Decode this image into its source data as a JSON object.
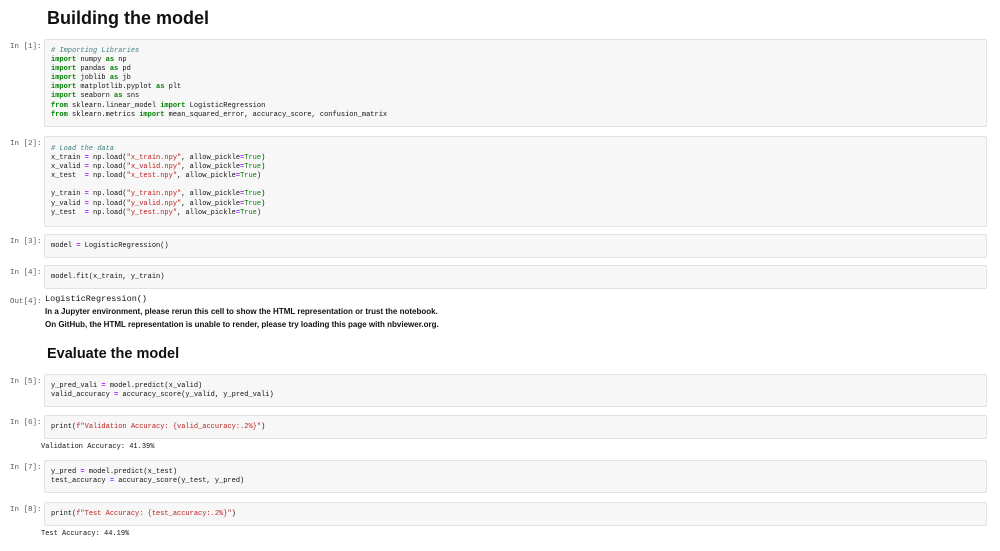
{
  "headings": {
    "build": "Building the model",
    "evaluate": "Evaluate the model"
  },
  "cells": [
    {
      "prompt": "In [1]:",
      "lines": [
        [
          {
            "t": "# Importing Libraries",
            "c": "cm"
          }
        ],
        [
          {
            "t": "import",
            "c": "kw"
          },
          {
            "t": " numpy "
          },
          {
            "t": "as",
            "c": "kw"
          },
          {
            "t": " np"
          }
        ],
        [
          {
            "t": "import",
            "c": "kw"
          },
          {
            "t": " pandas "
          },
          {
            "t": "as",
            "c": "kw"
          },
          {
            "t": " pd"
          }
        ],
        [
          {
            "t": "import",
            "c": "kw"
          },
          {
            "t": " joblib "
          },
          {
            "t": "as",
            "c": "kw"
          },
          {
            "t": " jb"
          }
        ],
        [
          {
            "t": "import",
            "c": "kw"
          },
          {
            "t": " matplotlib.pyplot "
          },
          {
            "t": "as",
            "c": "kw"
          },
          {
            "t": " plt"
          }
        ],
        [
          {
            "t": "import",
            "c": "kw"
          },
          {
            "t": " seaborn "
          },
          {
            "t": "as",
            "c": "kw"
          },
          {
            "t": " sns"
          }
        ],
        [
          {
            "t": "from",
            "c": "kw"
          },
          {
            "t": " sklearn.linear_model "
          },
          {
            "t": "import",
            "c": "kw"
          },
          {
            "t": " LogisticRegression"
          }
        ],
        [
          {
            "t": "from",
            "c": "kw"
          },
          {
            "t": " sklearn.metrics "
          },
          {
            "t": "import",
            "c": "kw"
          },
          {
            "t": " mean_squared_error, accuracy_score, confusion_matrix"
          }
        ]
      ]
    },
    {
      "prompt": "In [2]:",
      "lines": [
        [
          {
            "t": "# Load the data",
            "c": "cm"
          }
        ],
        [
          {
            "t": "x_train "
          },
          {
            "t": "=",
            "c": "op"
          },
          {
            "t": " np.load("
          },
          {
            "t": "\"x_train.npy\"",
            "c": "st"
          },
          {
            "t": ", allow_pickle"
          },
          {
            "t": "=",
            "c": "op"
          },
          {
            "t": "True",
            "c": "kt"
          },
          {
            "t": ")"
          }
        ],
        [
          {
            "t": "x_valid "
          },
          {
            "t": "=",
            "c": "op"
          },
          {
            "t": " np.load("
          },
          {
            "t": "\"x_valid.npy\"",
            "c": "st"
          },
          {
            "t": ", allow_pickle"
          },
          {
            "t": "=",
            "c": "op"
          },
          {
            "t": "True",
            "c": "kt"
          },
          {
            "t": ")"
          }
        ],
        [
          {
            "t": "x_test  "
          },
          {
            "t": "=",
            "c": "op"
          },
          {
            "t": " np.load("
          },
          {
            "t": "\"x_test.npy\"",
            "c": "st"
          },
          {
            "t": ", allow_pickle"
          },
          {
            "t": "=",
            "c": "op"
          },
          {
            "t": "True",
            "c": "kt"
          },
          {
            "t": ")"
          }
        ],
        [
          {
            "t": ""
          }
        ],
        [
          {
            "t": "y_train "
          },
          {
            "t": "=",
            "c": "op"
          },
          {
            "t": " np.load("
          },
          {
            "t": "\"y_train.npy\"",
            "c": "st"
          },
          {
            "t": ", allow_pickle"
          },
          {
            "t": "=",
            "c": "op"
          },
          {
            "t": "True",
            "c": "kt"
          },
          {
            "t": ")"
          }
        ],
        [
          {
            "t": "y_valid "
          },
          {
            "t": "=",
            "c": "op"
          },
          {
            "t": " np.load("
          },
          {
            "t": "\"y_valid.npy\"",
            "c": "st"
          },
          {
            "t": ", allow_pickle"
          },
          {
            "t": "=",
            "c": "op"
          },
          {
            "t": "True",
            "c": "kt"
          },
          {
            "t": ")"
          }
        ],
        [
          {
            "t": "y_test  "
          },
          {
            "t": "=",
            "c": "op"
          },
          {
            "t": " np.load("
          },
          {
            "t": "\"y_test.npy\"",
            "c": "st"
          },
          {
            "t": ", allow_pickle"
          },
          {
            "t": "=",
            "c": "op"
          },
          {
            "t": "True",
            "c": "kt"
          },
          {
            "t": ")"
          }
        ]
      ]
    },
    {
      "prompt": "In [3]:",
      "lines": [
        [
          {
            "t": "model "
          },
          {
            "t": "=",
            "c": "op"
          },
          {
            "t": " LogisticRegression()"
          }
        ]
      ]
    },
    {
      "prompt": "In [4]:",
      "lines": [
        [
          {
            "t": "model.fit(x_train, y_train)"
          }
        ]
      ]
    },
    {
      "prompt": "In [5]:",
      "lines": [
        [
          {
            "t": "y_pred_vali "
          },
          {
            "t": "=",
            "c": "op"
          },
          {
            "t": " model.predict(x_valid)"
          }
        ],
        [
          {
            "t": "valid_accuracy "
          },
          {
            "t": "=",
            "c": "op"
          },
          {
            "t": " accuracy_score(y_valid, y_pred_vali)"
          }
        ]
      ]
    },
    {
      "prompt": "In [6]:",
      "lines": [
        [
          {
            "t": "print("
          },
          {
            "t": "f\"Validation Accuracy: {valid_accuracy:.2%}\"",
            "c": "st"
          },
          {
            "t": ")"
          }
        ]
      ]
    },
    {
      "prompt": "In [7]:",
      "lines": [
        [
          {
            "t": "y_pred "
          },
          {
            "t": "=",
            "c": "op"
          },
          {
            "t": " model.predict(x_test)"
          }
        ],
        [
          {
            "t": "test_accuracy "
          },
          {
            "t": "=",
            "c": "op"
          },
          {
            "t": " accuracy_score(y_test, y_pred)"
          }
        ]
      ]
    },
    {
      "prompt": "In [8]:",
      "lines": [
        [
          {
            "t": "print("
          },
          {
            "t": "f\"Test Accuracy: {test_accuracy:.2%}\"",
            "c": "st"
          },
          {
            "t": ")"
          }
        ]
      ]
    }
  ],
  "outputs": {
    "out4_prompt": "Out[4]:",
    "out4_repr": "LogisticRegression()",
    "out4_warn1": "In a Jupyter environment, please rerun this cell to show the HTML representation or trust the notebook.",
    "out4_warn2": "On GitHub, the HTML representation is unable to render, please try loading this page with nbviewer.org.",
    "out6": "Validation Accuracy: 41.39%",
    "out8": "Test Accuracy: 44.19%"
  },
  "colors": {
    "keyword": "#008000",
    "comment": "#408080",
    "string": "#ba2121",
    "operator": "#aa22ff",
    "cell_bg": "#f7f7f7",
    "cell_border": "#e3e3e3"
  }
}
